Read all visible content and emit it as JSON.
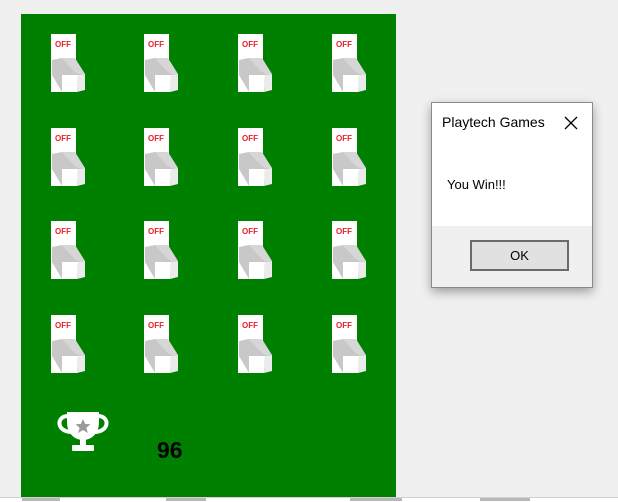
{
  "game": {
    "switch_label": "OFF",
    "switch_states": [
      [
        "OFF",
        "OFF",
        "OFF",
        "OFF"
      ],
      [
        "OFF",
        "OFF",
        "OFF",
        "OFF"
      ],
      [
        "OFF",
        "OFF",
        "OFF",
        "OFF"
      ],
      [
        "OFF",
        "OFF",
        "OFF",
        "OFF"
      ]
    ],
    "score": "96",
    "trophy_icon": "trophy-star-icon",
    "colors": {
      "board": "#008000",
      "switch_label": "#e8212b",
      "switch_body": "#ffffff"
    }
  },
  "dialog": {
    "title": "Playtech Games",
    "message": "You Win!!!",
    "ok_label": "OK",
    "close_icon": "close-icon"
  }
}
